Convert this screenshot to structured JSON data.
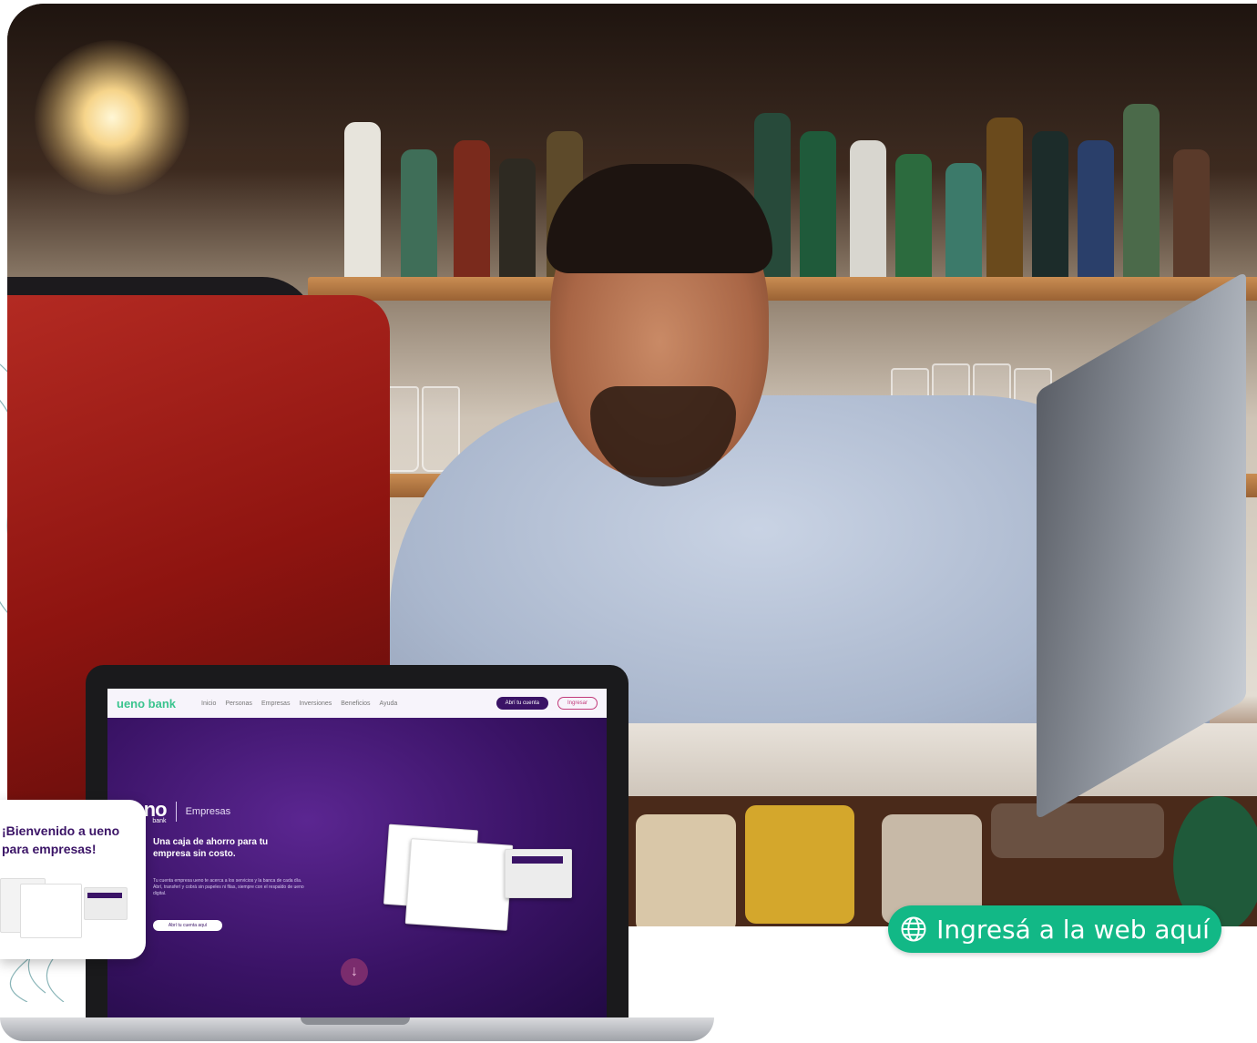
{
  "cta": {
    "label": "Ingresá a la web aquí",
    "icon": "globe-icon",
    "color": "#12b886"
  },
  "popup": {
    "title": "¡Bienvenido a ueno para empresas!"
  },
  "laptop_site": {
    "nav": {
      "logo": "ueno bank",
      "links": [
        "Inicio",
        "Personas",
        "Empresas",
        "Inversiones",
        "Beneficios",
        "Ayuda"
      ],
      "primary_button": "Abrí tu cuenta",
      "secondary_button": "Ingresar"
    },
    "brand": {
      "name": "ueno",
      "sub": "bank",
      "section": "Empresas"
    },
    "headline": "Una caja de ahorro para tu empresa sin costo.",
    "body": "Tu cuenta empresa ueno te acerca a los servicios y la banca de cada día. Abrí, transferí y cobrá sin papeles ni filas, siempre con el respaldo de ueno digital.",
    "cta": "Abrí tu cuenta aquí",
    "brand_color": "#3a1366",
    "accent_color": "#3ac48e"
  }
}
